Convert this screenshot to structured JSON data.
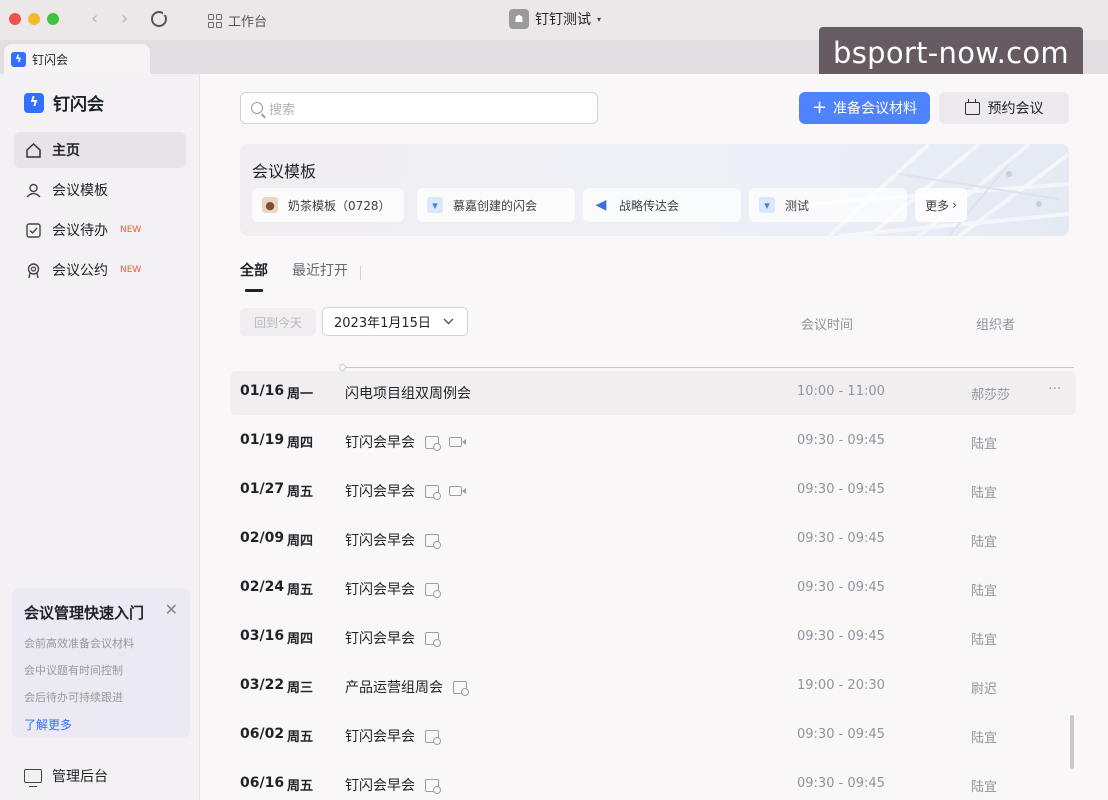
{
  "titlebar": {
    "workbench_label": "工作台",
    "org_name": "钉钉测试",
    "org_caret": "▾"
  },
  "tab": {
    "label": "钉闪会"
  },
  "watermark": "bsport-now.com",
  "sidebar": {
    "brand": "钉闪会",
    "items": [
      {
        "label": "主页",
        "icon": "home-icon",
        "badge": ""
      },
      {
        "label": "会议模板",
        "icon": "template-icon",
        "badge": ""
      },
      {
        "label": "会议待办",
        "icon": "todo-icon",
        "badge": "NEW"
      },
      {
        "label": "会议公约",
        "icon": "award-icon",
        "badge": "NEW"
      }
    ],
    "quick_start": {
      "title": "会议管理快速入门",
      "lines": [
        "会前高效准备会议材料",
        "会中议题有时间控制",
        "会后待办可持续跟进"
      ],
      "more": "了解更多"
    },
    "admin": "管理后台"
  },
  "toolbar": {
    "search_placeholder": "搜索",
    "prepare_button": "准备会议材料",
    "book_button": "预约会议"
  },
  "templates": {
    "title": "会议模板",
    "items": [
      {
        "label": "奶茶模板（0728）",
        "icon": "milk-tea-icon"
      },
      {
        "label": "慕嘉创建的闪会",
        "icon": "tshirt-icon"
      },
      {
        "label": "战略传达会",
        "icon": "megaphone-icon"
      },
      {
        "label": "测试",
        "icon": "tshirt-icon"
      }
    ],
    "more": "更多"
  },
  "tabs": {
    "all": "全部",
    "recent": "最近打开"
  },
  "filters": {
    "today_button": "回到今天",
    "date_value": "2023年1月15日"
  },
  "columns": {
    "time": "会议时间",
    "organizer": "组织者"
  },
  "meetings": [
    {
      "date": "01/16",
      "weekday": "周一",
      "title": "闪电项目组双周例会",
      "time": "10:00 - 11:00",
      "organizer": "郝莎莎",
      "icons": [],
      "highlight": true,
      "more": "···"
    },
    {
      "date": "01/19",
      "weekday": "周四",
      "title": "钉闪会早会",
      "time": "09:30 - 09:45",
      "organizer": "陆宜",
      "icons": [
        "schedule-icon",
        "video-icon"
      ]
    },
    {
      "date": "01/27",
      "weekday": "周五",
      "title": "钉闪会早会",
      "time": "09:30 - 09:45",
      "organizer": "陆宜",
      "icons": [
        "schedule-icon",
        "video-icon"
      ]
    },
    {
      "date": "02/09",
      "weekday": "周四",
      "title": "钉闪会早会",
      "time": "09:30 - 09:45",
      "organizer": "陆宜",
      "icons": [
        "schedule-icon"
      ]
    },
    {
      "date": "02/24",
      "weekday": "周五",
      "title": "钉闪会早会",
      "time": "09:30 - 09:45",
      "organizer": "陆宜",
      "icons": [
        "schedule-icon"
      ]
    },
    {
      "date": "03/16",
      "weekday": "周四",
      "title": "钉闪会早会",
      "time": "09:30 - 09:45",
      "organizer": "陆宜",
      "icons": [
        "schedule-icon"
      ]
    },
    {
      "date": "03/22",
      "weekday": "周三",
      "title": "产品运营组周会",
      "time": "19:00 - 20:30",
      "organizer": "尉迟",
      "icons": [
        "schedule-icon"
      ]
    },
    {
      "date": "06/02",
      "weekday": "周五",
      "title": "钉闪会早会",
      "time": "09:30 - 09:45",
      "organizer": "陆宜",
      "icons": [
        "schedule-icon"
      ]
    },
    {
      "date": "06/16",
      "weekday": "周五",
      "title": "钉闪会早会",
      "time": "09:30 - 09:45",
      "organizer": "陆宜",
      "icons": [
        "schedule-icon"
      ]
    }
  ]
}
